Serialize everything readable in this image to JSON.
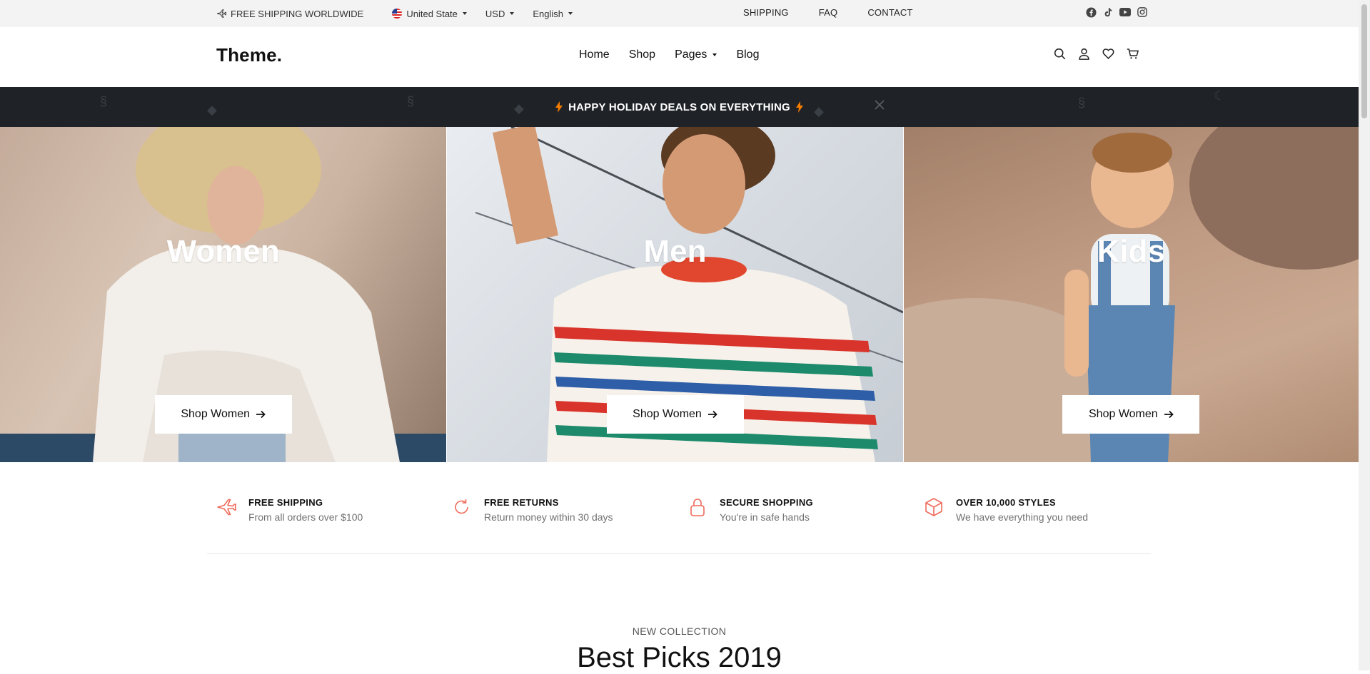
{
  "topbar": {
    "shipping_text": "FREE SHIPPING WORLDWIDE",
    "country": "United State",
    "currency": "USD",
    "language": "English",
    "links": [
      "SHIPPING",
      "FAQ",
      "CONTACT"
    ],
    "social_icons": [
      "facebook-icon",
      "tiktok-icon",
      "youtube-icon",
      "instagram-icon"
    ]
  },
  "header": {
    "logo": "Theme.",
    "nav": {
      "home": "Home",
      "shop": "Shop",
      "pages": "Pages",
      "blog": "Blog"
    },
    "icons": [
      "search-icon",
      "user-icon",
      "heart-icon",
      "cart-icon"
    ]
  },
  "promo": {
    "text": "HAPPY HOLIDAY DEALS ON EVERYTHING",
    "accent": "#f57c00"
  },
  "hero": {
    "panels": [
      {
        "title": "Women",
        "button": "Shop Women"
      },
      {
        "title": "Men",
        "button": "Shop Women"
      },
      {
        "title": "Kids",
        "button": "Shop Women"
      }
    ]
  },
  "features": [
    {
      "icon": "plane-icon",
      "title": "FREE SHIPPING",
      "subtitle": "From all orders over $100"
    },
    {
      "icon": "refresh-icon",
      "title": "FREE RETURNS",
      "subtitle": "Return money within 30 days"
    },
    {
      "icon": "lock-icon",
      "title": "SECURE SHOPPING",
      "subtitle": "You're in safe hands"
    },
    {
      "icon": "box-icon",
      "title": "OVER 10,000 STYLES",
      "subtitle": "We have everything you need"
    }
  ],
  "feature_icon_color": "#ef6a5a",
  "collection": {
    "eyebrow": "NEW COLLECTION",
    "title": "Best Picks 2019"
  }
}
